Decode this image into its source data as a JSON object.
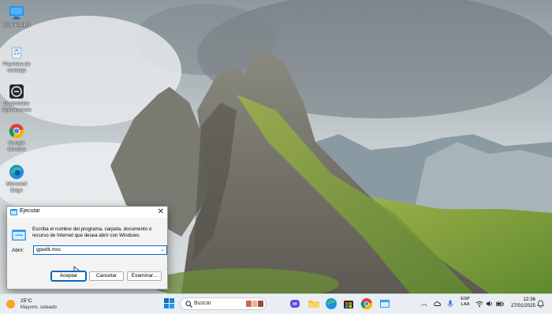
{
  "desktop": {
    "icons": [
      {
        "label": "Este equipo",
        "icon": "monitor-icon"
      },
      {
        "label": "Papelera de reciclaje",
        "icon": "recycle-bin-icon"
      },
      {
        "label": "Desinstalar Aplicaciones",
        "icon": "uninstall-icon"
      },
      {
        "label": "Google Chrome",
        "icon": "chrome-icon"
      },
      {
        "label": "Microsoft Edge",
        "icon": "edge-icon"
      }
    ]
  },
  "run_dialog": {
    "title": "Ejecutar",
    "close_glyph": "✕",
    "description": "Escriba el nombre del programa, carpeta, documento o recurso de Internet que desea abrir con Windows.",
    "open_label": "Abrir:",
    "open_value": "gpedit.msc",
    "buttons": {
      "ok": "Aceptar",
      "cancel": "Cancelar",
      "browse": "Examinar..."
    }
  },
  "taskbar": {
    "weather": {
      "temp": "25°C",
      "desc": "Mayorm. soleado"
    },
    "search_placeholder": "Buscar",
    "pinned": [
      "copilot-icon",
      "file-explorer-icon",
      "edge-icon",
      "store-icon",
      "chrome-icon",
      "run-app-icon"
    ],
    "tray": {
      "lang_top": "ESP",
      "lang_bottom": "LAA",
      "time": "12:36",
      "date": "27/01/2025"
    }
  },
  "colors": {
    "accent": "#0067c0",
    "taskbar_bg": "#e9eef2",
    "dialog_bg": "#f3f3f3"
  }
}
